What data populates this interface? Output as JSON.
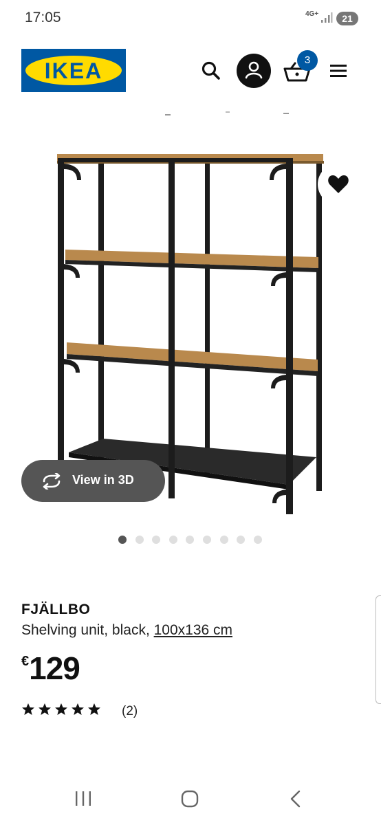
{
  "status_bar": {
    "time": "17:05",
    "network": "4G+",
    "battery": "21"
  },
  "header": {
    "logo_text": "IKEA",
    "cart_count": "3"
  },
  "product": {
    "name": "FJÄLLBO",
    "description": "Shelving unit, black, ",
    "dimensions": "100x136 cm",
    "currency": "€",
    "price": "129",
    "rating_stars": 5,
    "review_count": "(2)"
  },
  "gallery": {
    "view_3d_label": "View in 3D",
    "image_count": 9,
    "active_index": 0
  },
  "colors": {
    "ikea_blue": "#0058a3",
    "ikea_yellow": "#ffdb00",
    "wood": "#b9894d",
    "frame": "#1c1c1c"
  }
}
